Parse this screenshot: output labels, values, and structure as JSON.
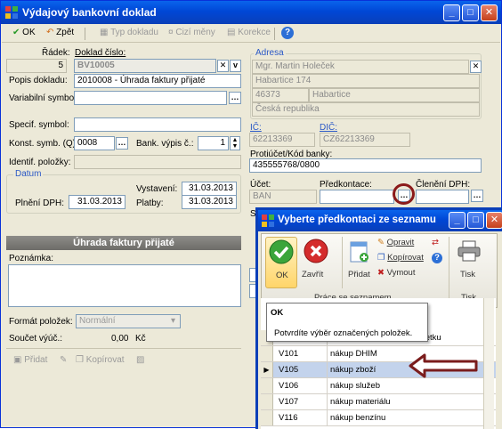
{
  "main_window": {
    "title": "Výdajový bankovní doklad",
    "toolbar": {
      "ok": "OK",
      "back": "Zpět",
      "doc_type": "Typ dokladu",
      "currencies": "Cizí měny",
      "correction": "Korekce"
    }
  },
  "form": {
    "radek_label": "Řádek:",
    "radek_value": "5",
    "doklad_cislo_label": "Doklad číslo:",
    "doklad_cislo_value": "BV10005",
    "popis_label": "Popis dokladu:",
    "popis_value": "2010008 - Úhrada faktury přijaté",
    "variabilni_label": "Variabilní symbol:",
    "specif_label": "Specif. symbol:",
    "konst_label": "Konst. symb. (Q):",
    "konst_value": "0008",
    "bank_vypis_label": "Bank. výpis č.:",
    "bank_vypis_value": "1",
    "ident_label": "Identif. položky:",
    "datum_label": "Datum",
    "vystaveni_label": "Vystavení:",
    "vystaveni_value": "31.03.2013",
    "plneni_label": "Plnění DPH:",
    "plneni_value": "31.03.2013",
    "platby_label": "Platby:",
    "platby_value": "31.03.2013",
    "section_title": "Úhrada faktury přijaté",
    "poznamka_label": "Poznámka:",
    "format_label": "Formát položek:",
    "format_value": "Normální",
    "soucet_label": "Součet výúč.:",
    "soucet_value": "0,00",
    "soucet_currency": "Kč",
    "bottom_add": "Přidat",
    "bottom_copy": "Kopírovat"
  },
  "address": {
    "label": "Adresa",
    "name": "Mgr. Martin Holeček",
    "street": "Habartice 174",
    "zip": "46373",
    "city": "Habartice",
    "country": "Česká republika",
    "ic_label": "IČ:",
    "ic_value": "62213369",
    "dic_label": "DIČ:",
    "dic_value": "CZ62213369",
    "account_label": "Protiúčet/Kód banky:",
    "account_value": "435555768/0800",
    "ucet_label": "Účet:",
    "ucet_value": "BAN",
    "predkontace_label": "Předkontace:",
    "cleneni_label": "Členění DPH:",
    "st_label": "Stř"
  },
  "popup": {
    "title": "Vyberte předkontaci ze seznamu",
    "ok_label": "OK",
    "close_label": "Zavřít",
    "add_label": "Přidat",
    "edit_label": "Opravit",
    "copy_label": "Kopírovat",
    "delete_label": "Vymout",
    "print_label": "Tisk",
    "group_label": "Práce se seznamem",
    "print_group_label": "Tisk",
    "tooltip_title": "OK",
    "tooltip_text": "Potvrdíte výběr označených položek.",
    "rows": [
      {
        "code": "",
        "name": "nákup dlouhodobého majetku"
      },
      {
        "code": "V101",
        "name": "nákup DHIM"
      },
      {
        "code": "V105",
        "name": "nákup zboží"
      },
      {
        "code": "V106",
        "name": "nákup služeb"
      },
      {
        "code": "V107",
        "name": "nákup materiálu"
      },
      {
        "code": "V116",
        "name": "nákup benzínu"
      }
    ]
  },
  "colors": {
    "title_blue": "#0a52e0",
    "highlight_circle": "#8b1a1a",
    "arrow": "#7a1c1c",
    "selection": "#c3d3ec"
  }
}
